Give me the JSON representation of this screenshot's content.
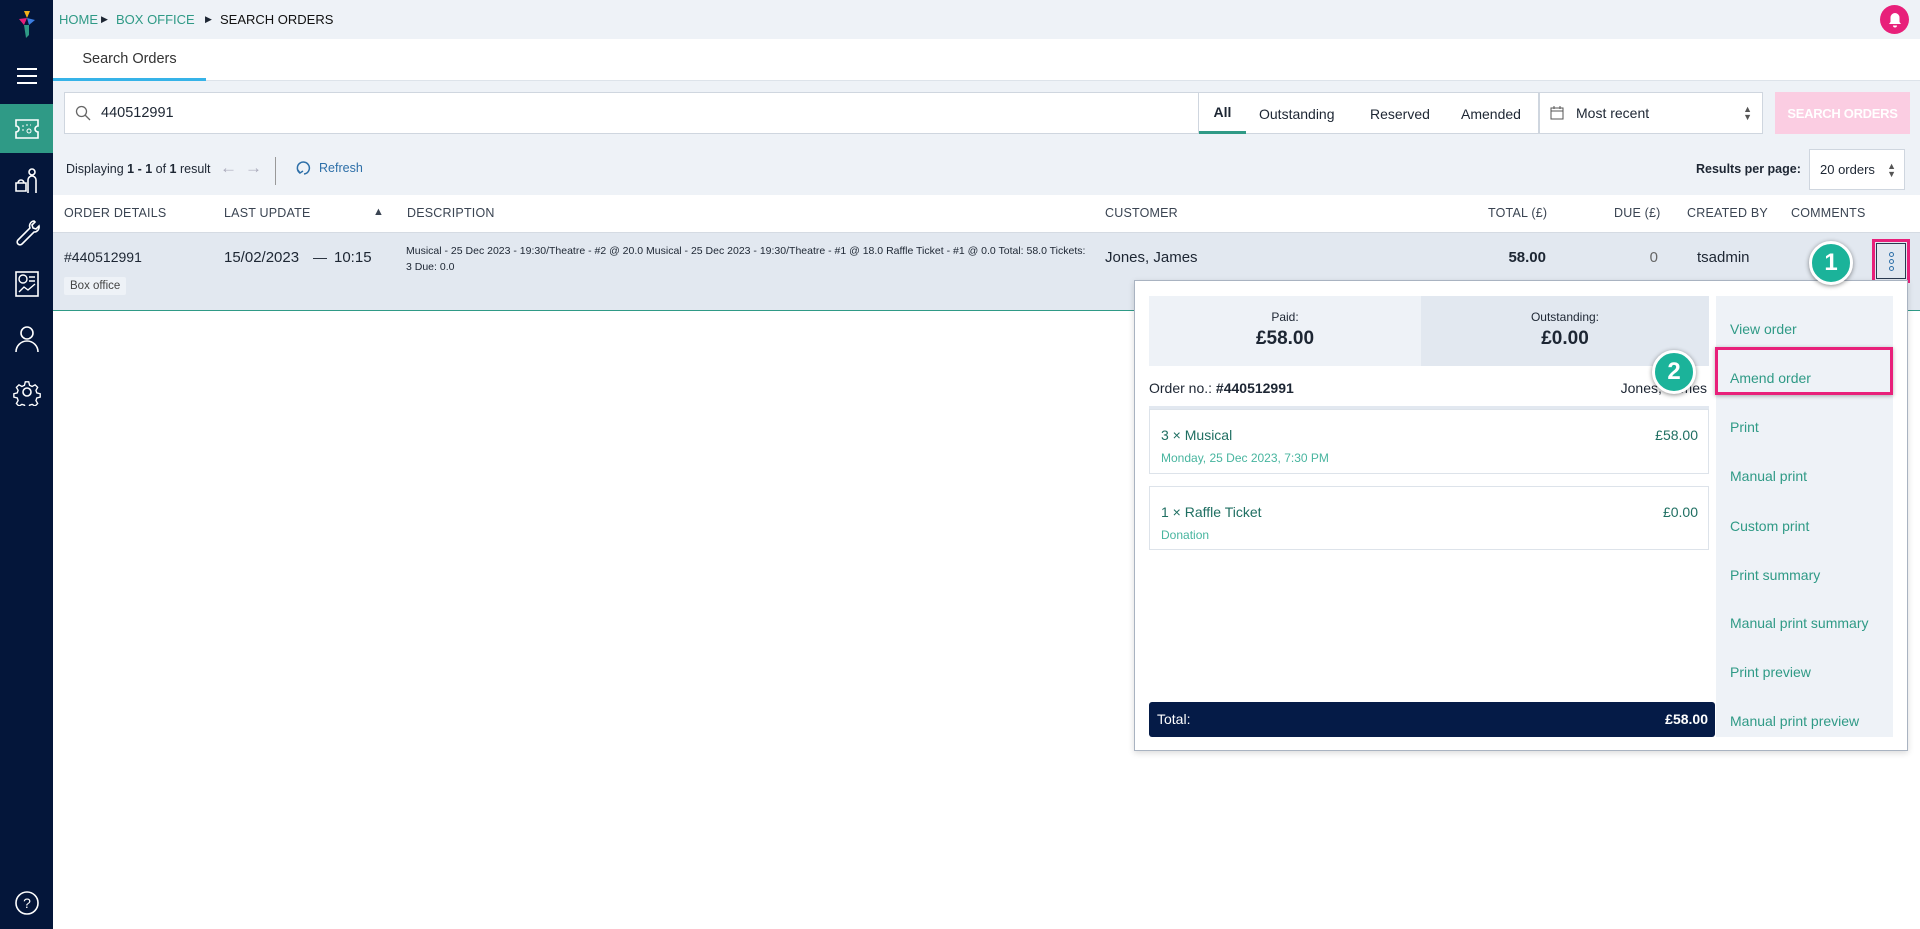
{
  "breadcrumb": [
    "HOME",
    "BOX OFFICE",
    "SEARCH ORDERS"
  ],
  "tab": "Search Orders",
  "search": {
    "value": "440512991"
  },
  "filters": [
    "All",
    "Outstanding",
    "Reserved",
    "Amended"
  ],
  "active_filter": "All",
  "sort": "Most recent",
  "search_button": "SEARCH ORDERS",
  "pagination": {
    "prefix": "Displaying ",
    "range": "1 - 1",
    "of": " of ",
    "total": "1",
    "suffix": " result",
    "refresh": "Refresh"
  },
  "results_per_page": {
    "label": "Results per page:",
    "value": "20 orders"
  },
  "columns": [
    "ORDER DETAILS",
    "LAST UPDATE",
    "DESCRIPTION",
    "CUSTOMER",
    "TOTAL (£)",
    "DUE (£)",
    "CREATED BY",
    "COMMENTS"
  ],
  "row": {
    "order": "#440512991",
    "channel": "Box office",
    "date": "15/02/2023",
    "dash": "—",
    "time": "10:15",
    "description": "Musical - 25 Dec 2023 - 19:30/Theatre - #2 @ 20.0 Musical - 25 Dec 2023 - 19:30/Theatre - #1 @ 18.0 Raffle Ticket - #1 @ 0.0 Total: 58.0 Tickets: 3 Due: 0.0",
    "customer": "Jones, James",
    "total": "58.00",
    "due": "0",
    "created_by": "tsadmin"
  },
  "popup": {
    "paid_label": "Paid:",
    "paid": "£58.00",
    "outstanding_label": "Outstanding:",
    "outstanding": "£0.00",
    "order_no_label": "Order no.: ",
    "order_no": "#440512991",
    "customer": "Jones, James",
    "items": [
      {
        "title": "3 × Musical",
        "price": "£58.00",
        "sub": "Monday, 25 Dec 2023, 7:30 PM"
      },
      {
        "title": "1 × Raffle Ticket",
        "price": "£0.00",
        "sub": "Donation"
      }
    ],
    "total_label": "Total:",
    "total": "£58.00",
    "menu": [
      "View order",
      "Amend order",
      "Print",
      "Manual print",
      "Custom print",
      "Print summary",
      "Manual print summary",
      "Print preview",
      "Manual print preview"
    ]
  },
  "steps": [
    "1",
    "2"
  ],
  "colors": {
    "sidebar": "#04163a",
    "accent": "#2f9a86",
    "highlight": "#e8207a",
    "notification": "#e8207a"
  }
}
